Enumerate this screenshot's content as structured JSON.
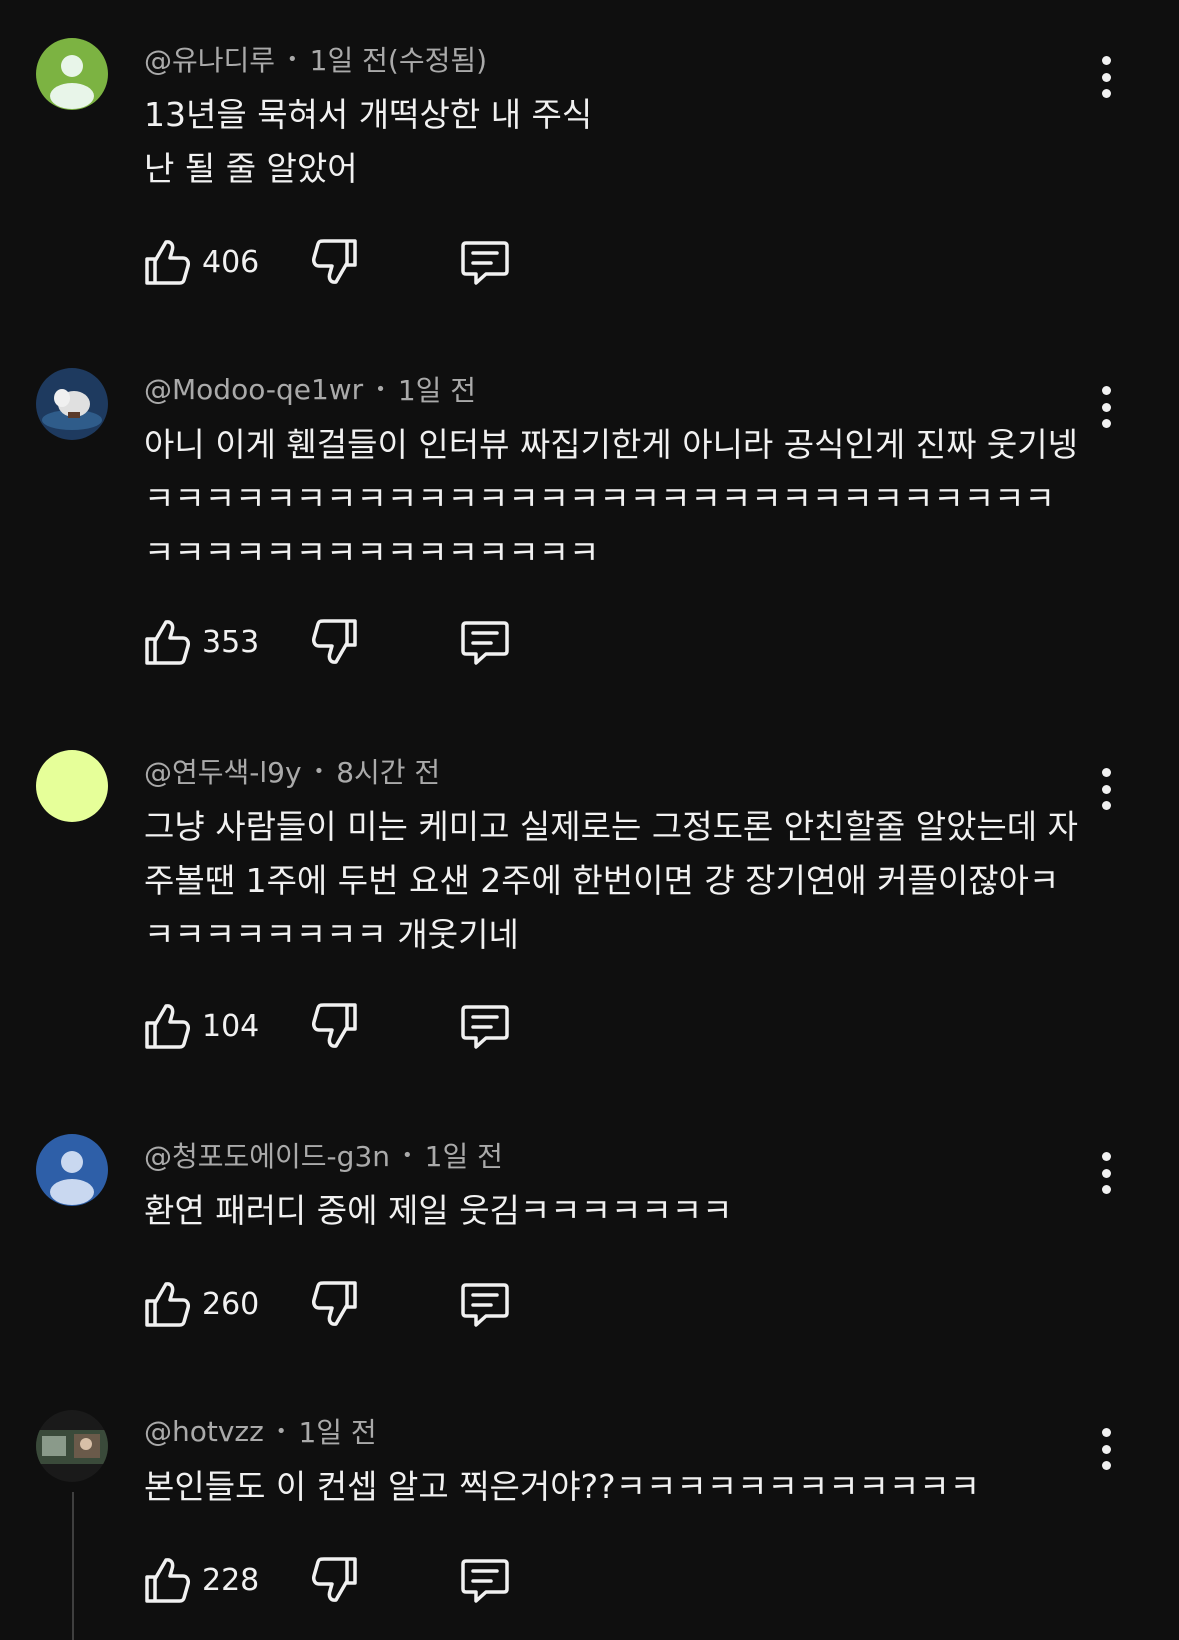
{
  "comments": [
    {
      "author": "@유나디루",
      "time": "1일 전(수정됨)",
      "text": "13년을 묵혀서 개떡상한 내 주식\n난 될 줄 알았어",
      "likes": "406",
      "avatar": {
        "type": "default-person-icon",
        "bg": "#7cb342",
        "fg": "#e8f5e9"
      }
    },
    {
      "author": "@Modoo-qe1wr",
      "time": "1일 전",
      "text": "아니 이게 휀걸들이 인터뷰 짜집기한게 아니라 공식인게 진짜 웃기넹ㅋㅋㅋㅋㅋㅋㅋㅋㅋㅋㅋㅋㅋㅋㅋㅋㅋㅋㅋㅋㅋㅋㅋㅋㅋㅋㅋㅋㅋㅋㅋㅋㅋㅋㅋㅋㅋㅋㅋㅋㅋㅋㅋㅋㅋ",
      "likes": "353",
      "avatar": {
        "type": "photo-avatar",
        "bg": "#1e3a5f",
        "fg": "#e0e0e0"
      }
    },
    {
      "author": "@연두색-l9y",
      "time": "8시간 전",
      "text": "그냥 사람들이 미는 케미고 실제로는 그정도론 안친할줄 알았는데 자주볼땐 1주에 두번 요샌 2주에 한번이면 걍 장기연애 커플이잖아ㅋㅋㅋㅋㅋㅋㅋㅋㅋ 개웃기네",
      "likes": "104",
      "avatar": {
        "type": "solid-color-avatar",
        "bg": "#e6ff99",
        "fg": "#e6ff99"
      }
    },
    {
      "author": "@청포도에이드-g3n",
      "time": "1일 전",
      "text": "환연 패러디 중에 제일 웃김ㅋㅋㅋㅋㅋㅋㅋ",
      "likes": "260",
      "avatar": {
        "type": "default-person-icon",
        "bg": "#2e5fa8",
        "fg": "#c9d8f0"
      }
    },
    {
      "author": "@hotvzz",
      "time": "1일 전",
      "text": "본인들도 이 컨셉 알고 찍은거야??ㅋㅋㅋㅋㅋㅋㅋㅋㅋㅋㅋㅋ",
      "likes": "228",
      "avatar": {
        "type": "photo-avatar",
        "bg": "#2b2b2b",
        "fg": "#8a9a8a"
      }
    }
  ],
  "icons": {
    "like": "thumbs-up-icon",
    "dislike": "thumbs-down-icon",
    "reply": "reply-comment-icon",
    "more": "more-vertical-icon"
  }
}
